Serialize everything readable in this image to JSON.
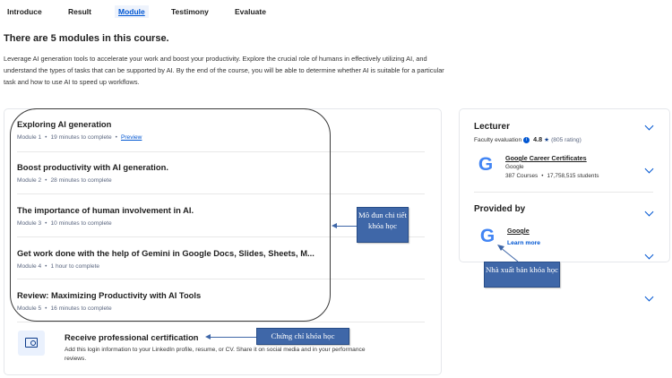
{
  "tabs": [
    {
      "label": "Introduce",
      "active": false
    },
    {
      "label": "Result",
      "active": false
    },
    {
      "label": "Module",
      "active": true
    },
    {
      "label": "Testimony",
      "active": false
    },
    {
      "label": "Evaluate",
      "active": false
    }
  ],
  "heading": "There are 5 modules in this course.",
  "description": "Leverage AI generation tools to accelerate your work and boost your productivity. Explore the crucial role of humans in effectively utilizing AI, and understand the types of tasks that can be supported by AI. By the end of the course, you will be able to determine whether AI is suitable for a particular task and how to use AI to speed up workflows.",
  "modules": [
    {
      "title": "Exploring AI generation",
      "number": "Module 1",
      "duration": "19 minutes to complete",
      "link": "Preview"
    },
    {
      "title": "Boost productivity with AI generation.",
      "number": "Module 2",
      "duration": "28 minutes to complete"
    },
    {
      "title": "The importance of human involvement in AI.",
      "number": "Module 3",
      "duration": "10 minutes to complete"
    },
    {
      "title": "Get work done with the help of Gemini in Google Docs, Slides, Sheets, M...",
      "number": "Module 4",
      "duration": "1 hour to complete"
    },
    {
      "title": "Review: Maximizing Productivity with AI Tools",
      "number": "Module 5",
      "duration": "16 minutes to complete"
    }
  ],
  "certificate": {
    "title": "Receive professional certification",
    "description": "Add this login information to your LinkedIn profile, resume, or CV. Share it on social media and in your performance reviews."
  },
  "lecturer": {
    "heading": "Lecturer",
    "evaluation_label": "Faculty evaluation",
    "info_glyph": "i",
    "rating": "4.8",
    "star": "★",
    "rating_count": "(805 rating)",
    "org_name": "Google Career Certificates",
    "org_sub": "Google",
    "courses": "387 Courses",
    "learners": "17,758,515 students"
  },
  "provider": {
    "heading": "Provided by",
    "name": "Google",
    "learn_more": "Learn more"
  },
  "logo_letter": "G",
  "callouts": {
    "modules": "Mô đun chi tiết khóa học",
    "certificate": "Chứng chỉ khóa học",
    "publisher": "Nhà xuất bản khóa học"
  },
  "colors": {
    "accent": "#0056d2",
    "callout": "#3f67a8",
    "google_blue": "#4285f4"
  }
}
